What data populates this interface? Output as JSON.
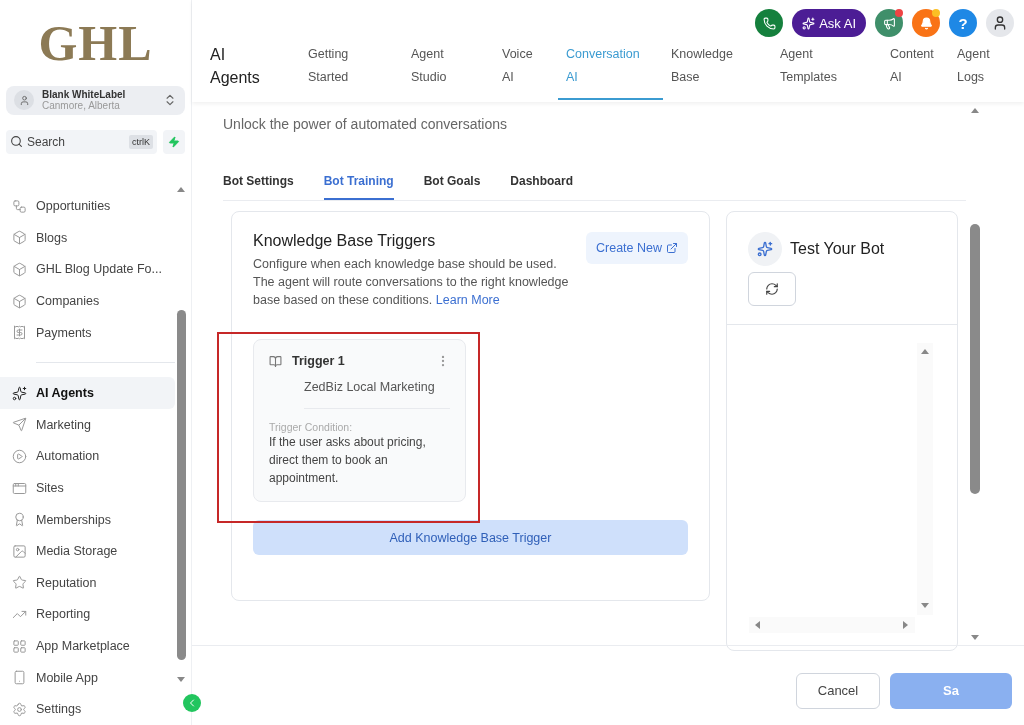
{
  "sidebar": {
    "logo": "GHL",
    "account": {
      "name": "Blank WhiteLabel",
      "location": "Canmore, Alberta"
    },
    "search": {
      "placeholder": "Search",
      "shortcut": "ctrlK"
    },
    "groups": [
      {
        "items": [
          {
            "label": "Opportunities",
            "selected": false
          },
          {
            "label": "Blogs",
            "selected": false
          },
          {
            "label": "GHL Blog Update Fo...",
            "selected": false
          },
          {
            "label": "Companies",
            "selected": false
          },
          {
            "label": "Payments",
            "selected": false
          }
        ]
      },
      {
        "items": [
          {
            "label": "AI Agents",
            "selected": true
          },
          {
            "label": "Marketing",
            "selected": false
          },
          {
            "label": "Automation",
            "selected": false
          },
          {
            "label": "Sites",
            "selected": false
          },
          {
            "label": "Memberships",
            "selected": false
          },
          {
            "label": "Media Storage",
            "selected": false
          },
          {
            "label": "Reputation",
            "selected": false
          },
          {
            "label": "Reporting",
            "selected": false
          },
          {
            "label": "App Marketplace",
            "selected": false
          },
          {
            "label": "Mobile App",
            "selected": false
          },
          {
            "label": "Settings",
            "selected": false
          }
        ]
      }
    ]
  },
  "header": {
    "ask_ai": "Ask AI",
    "help": "?",
    "section_title": "AI Agents",
    "tabs": [
      {
        "label": "Getting Started",
        "selected": false
      },
      {
        "label": "Agent Studio",
        "selected": false
      },
      {
        "label": "Voice AI",
        "selected": false
      },
      {
        "label": "Conversation AI",
        "selected": true
      },
      {
        "label": "Knowledge Base",
        "selected": false
      },
      {
        "label": "Agent Templates",
        "selected": false
      },
      {
        "label": "Content AI",
        "selected": false
      },
      {
        "label": "Agent Logs",
        "selected": false
      }
    ]
  },
  "page": {
    "subtitle": "Unlock the power of automated conversations",
    "tabs": [
      {
        "label": "Bot Settings",
        "selected": false
      },
      {
        "label": "Bot Training",
        "selected": true
      },
      {
        "label": "Bot Goals",
        "selected": false
      },
      {
        "label": "Dashboard",
        "selected": false
      }
    ]
  },
  "triggers_card": {
    "title": "Knowledge Base Triggers",
    "description": "Configure when each knowledge base should be used. The agent will route conversations to the right knowledge base based on these conditions.",
    "link": "Learn More",
    "create_button": "Create New",
    "triggers": [
      {
        "name": "Trigger 1",
        "knowledge_base": "ZedBiz Local Marketing",
        "condition_label": "Trigger Condition:",
        "condition": "If the user asks about pricing, direct them to book an appointment.",
        "highlighted": true
      }
    ],
    "add_button": "Add Knowledge Base Trigger"
  },
  "test_panel": {
    "title": "Test Your Bot"
  },
  "footer": {
    "cancel": "Cancel",
    "save": "Sa"
  }
}
